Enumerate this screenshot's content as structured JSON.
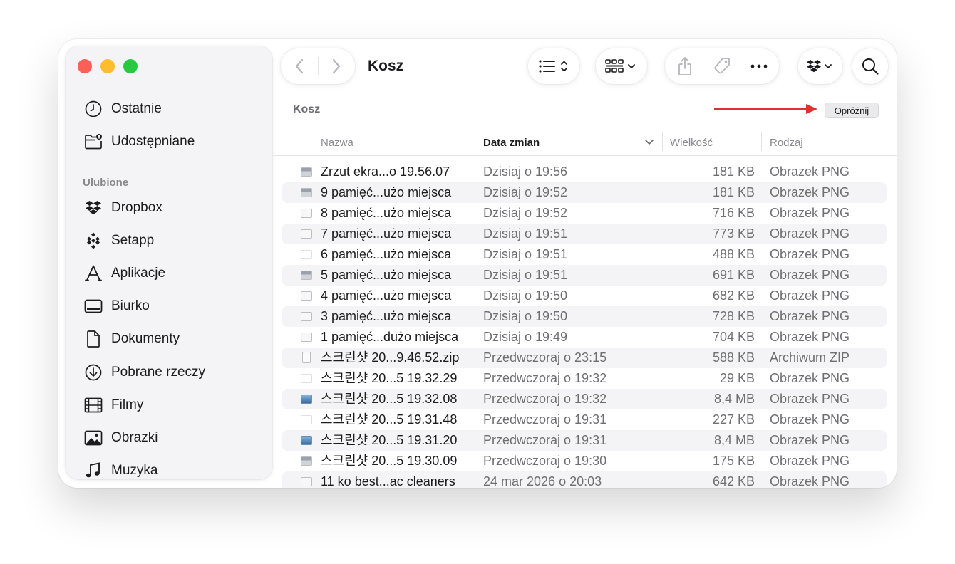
{
  "window": {
    "title": "Kosz"
  },
  "sidebar": {
    "section_favorites": "Ulubione",
    "items": [
      {
        "label": "Ostatnie",
        "icon": "clock-icon"
      },
      {
        "label": "Udostępniane",
        "icon": "shared-folder-icon"
      },
      {
        "label": "Dropbox",
        "icon": "dropbox-icon"
      },
      {
        "label": "Setapp",
        "icon": "setapp-icon"
      },
      {
        "label": "Aplikacje",
        "icon": "applications-icon"
      },
      {
        "label": "Biurko",
        "icon": "desktop-icon"
      },
      {
        "label": "Dokumenty",
        "icon": "document-icon"
      },
      {
        "label": "Pobrane rzeczy",
        "icon": "download-icon"
      },
      {
        "label": "Filmy",
        "icon": "film-icon"
      },
      {
        "label": "Obrazki",
        "icon": "photo-icon"
      },
      {
        "label": "Muzyka",
        "icon": "music-icon"
      }
    ]
  },
  "pathbar": {
    "location": "Kosz",
    "empty_button": "Opróżnij"
  },
  "table": {
    "columns": {
      "name": "Nazwa",
      "date": "Data zmian",
      "size": "Wielkość",
      "kind": "Rodzaj"
    },
    "rows": [
      {
        "name": "Zrzut ekra...o 19.56.07",
        "date": "Dzisiaj o 19:56",
        "size": "181 KB",
        "kind": "Obrazek PNG"
      },
      {
        "name": "9 pamięć...użo miejsca",
        "date": "Dzisiaj o 19:52",
        "size": "181 KB",
        "kind": "Obrazek PNG"
      },
      {
        "name": "8 pamięć...użo miejsca",
        "date": "Dzisiaj o 19:52",
        "size": "716 KB",
        "kind": "Obrazek PNG"
      },
      {
        "name": "7 pamięć...użo miejsca",
        "date": "Dzisiaj o 19:51",
        "size": "773 KB",
        "kind": "Obrazek PNG"
      },
      {
        "name": "6 pamięć...użo miejsca",
        "date": "Dzisiaj o 19:51",
        "size": "488 KB",
        "kind": "Obrazek PNG"
      },
      {
        "name": "5 pamięć...użo miejsca",
        "date": "Dzisiaj o 19:51",
        "size": "691 KB",
        "kind": "Obrazek PNG"
      },
      {
        "name": "4 pamięć...użo miejsca",
        "date": "Dzisiaj o 19:50",
        "size": "682 KB",
        "kind": "Obrazek PNG"
      },
      {
        "name": "3 pamięć...użo miejsca",
        "date": "Dzisiaj o 19:50",
        "size": "728 KB",
        "kind": "Obrazek PNG"
      },
      {
        "name": "1 pamięć...dużo miejsca",
        "date": "Dzisiaj o 19:49",
        "size": "704 KB",
        "kind": "Obrazek PNG"
      },
      {
        "name": "스크린샷 20...9.46.52.zip",
        "date": "Przedwczoraj o 23:15",
        "size": "588 KB",
        "kind": "Archiwum ZIP"
      },
      {
        "name": "스크린샷 20...5 19.32.29",
        "date": "Przedwczoraj o 19:32",
        "size": "29 KB",
        "kind": "Obrazek PNG"
      },
      {
        "name": "스크린샷 20...5 19.32.08",
        "date": "Przedwczoraj o 19:32",
        "size": "8,4 MB",
        "kind": "Obrazek PNG"
      },
      {
        "name": "스크린샷 20...5 19.31.48",
        "date": "Przedwczoraj o 19:31",
        "size": "227 KB",
        "kind": "Obrazek PNG"
      },
      {
        "name": "스크린샷 20...5 19.31.20",
        "date": "Przedwczoraj o 19:31",
        "size": "8,4 MB",
        "kind": "Obrazek PNG"
      },
      {
        "name": "스크린샷 20...5 19.30.09",
        "date": "Przedwczoraj o 19:30",
        "size": "175 KB",
        "kind": "Obrazek PNG"
      },
      {
        "name": "11 ko best...ac cleaners",
        "date": "24 mar 2026 o 20:03",
        "size": "642 KB",
        "kind": "Obrazek PNG"
      }
    ]
  },
  "colors": {
    "close": "#fe5f57",
    "minimize": "#febc2e",
    "zoom": "#28c840",
    "annotation_arrow": "#e03131"
  }
}
